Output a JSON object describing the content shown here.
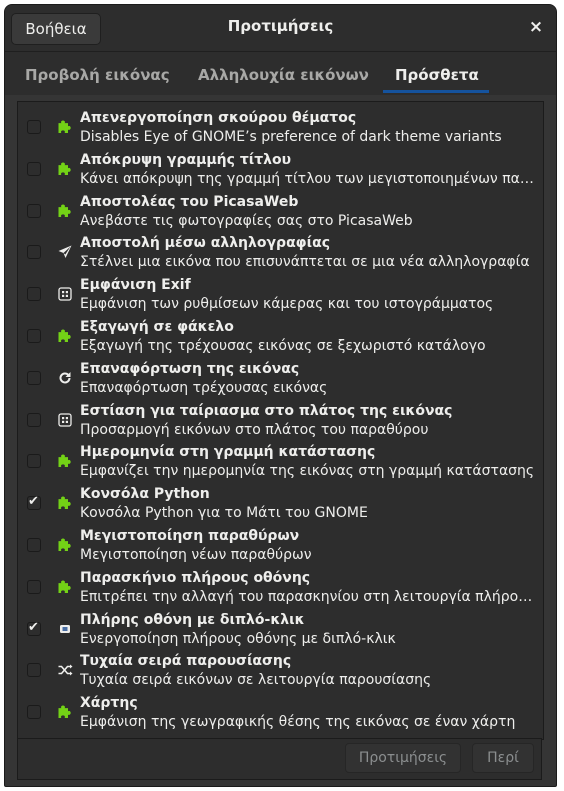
{
  "window": {
    "title": "Προτιμήσεις",
    "help_label": "Βοήθεια",
    "close_glyph": "×"
  },
  "tabs": [
    {
      "label": "Προβολή εικόνας",
      "active": false
    },
    {
      "label": "Αλληλουχία εικόνων",
      "active": false
    },
    {
      "label": "Πρόσθετα",
      "active": true
    }
  ],
  "plugins": [
    {
      "title": "Απενεργοποίηση σκούρου θέματος",
      "desc": "Disables Eye of GNOME’s preference of dark theme variants",
      "checked": false,
      "icon": "puzzle-icon"
    },
    {
      "title": "Απόκρυψη γραμμής τίτλου",
      "desc": "Κάνει απόκρυψη της γραμμή τίτλου των μεγιστοποιημένων παραθύρων",
      "checked": false,
      "icon": "puzzle-icon"
    },
    {
      "title": "Αποστολέας του PicasaWeb",
      "desc": "Ανεβάστε τις φωτογραφίες σας στο PicasaWeb",
      "checked": false,
      "icon": "puzzle-icon"
    },
    {
      "title": "Αποστολή μέσω αλληλογραφίας",
      "desc": "Στέλνει μια εικόνα που επισυνάπτεται σε μια νέα αλληλογραφία",
      "checked": false,
      "icon": "send-icon"
    },
    {
      "title": "Εμφάνιση Exif",
      "desc": "Εμφάνιση των ρυθμίσεων κάμερας και του ιστογράμματος",
      "checked": false,
      "icon": "exif-icon"
    },
    {
      "title": "Εξαγωγή σε φάκελο",
      "desc": "Εξαγωγή της τρέχουσας εικόνας σε ξεχωριστό κατάλογο",
      "checked": false,
      "icon": "puzzle-icon"
    },
    {
      "title": "Επαναφόρτωση της εικόνας",
      "desc": "Επαναφόρτωση τρέχουσας εικόνας",
      "checked": false,
      "icon": "reload-icon"
    },
    {
      "title": "Εστίαση για ταίριασμα στο πλάτος της εικόνας",
      "desc": "Προσαρμογή εικόνων στο πλάτος του παραθύρου",
      "checked": false,
      "icon": "zoom-fit-icon"
    },
    {
      "title": "Ημερομηνία στη γραμμή κατάστασης",
      "desc": "Εμφανίζει την ημερομηνία της εικόνας στη γραμμή κατάστασης",
      "checked": false,
      "icon": "puzzle-icon"
    },
    {
      "title": "Κονσόλα Python",
      "desc": "Κονσόλα Python για το Μάτι του GNOME",
      "checked": true,
      "icon": "puzzle-icon"
    },
    {
      "title": "Μεγιστοποίηση παραθύρων",
      "desc": "Μεγιστοποίηση νέων παραθύρων",
      "checked": false,
      "icon": "puzzle-icon"
    },
    {
      "title": "Παρασκήνιο πλήρους οθόνης",
      "desc": "Επιτρέπει την αλλαγή του παρασκηνίου στη λειτουργία πλήρους οθόνης",
      "checked": false,
      "icon": "puzzle-icon"
    },
    {
      "title": "Πλήρης οθόνη με διπλό-κλικ",
      "desc": "Ενεργοποίηση πλήρους οθόνης με διπλό-κλικ",
      "checked": true,
      "icon": "fullscreen-icon"
    },
    {
      "title": "Τυχαία σειρά παρουσίασης",
      "desc": "Τυχαία σειρά εικόνων σε λειτουργία παρουσίασης",
      "checked": false,
      "icon": "shuffle-icon"
    },
    {
      "title": "Χάρτης",
      "desc": "Εμφάνιση της γεωγραφικής θέσης της εικόνας σε έναν χάρτη",
      "checked": false,
      "icon": "puzzle-icon"
    }
  ],
  "footer": {
    "preferences_label": "Προτιμήσεις",
    "about_label": "Περί"
  },
  "colors": {
    "plugin_green": "#73d216",
    "accent": "#15539e"
  }
}
